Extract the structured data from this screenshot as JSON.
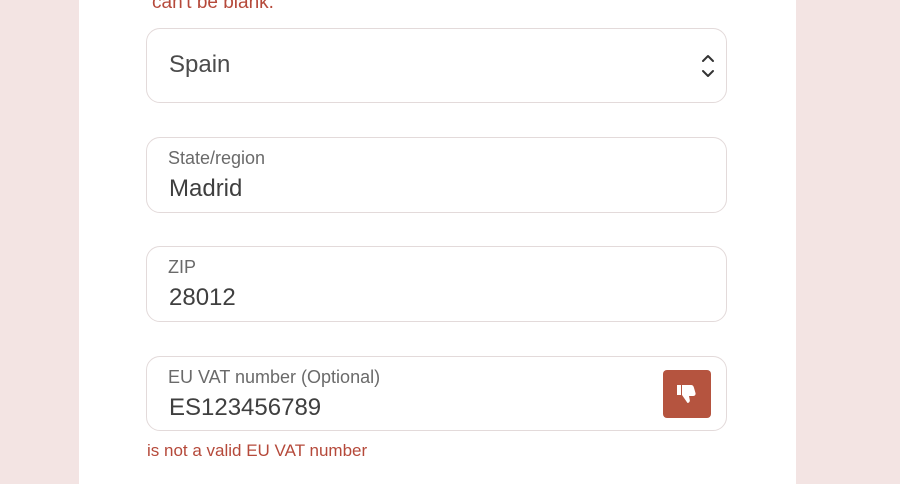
{
  "form": {
    "top_error": "can't be blank.",
    "country": {
      "value": "Spain",
      "icon": "chevron-up-down-icon"
    },
    "state": {
      "label": "State/region",
      "value": "Madrid"
    },
    "zip": {
      "label": "ZIP",
      "value": "28012"
    },
    "vat": {
      "label": "EU VAT number (Optional)",
      "value": "ES123456789",
      "icon": "thumbs-down-icon",
      "error": "is not a valid EU VAT number"
    }
  },
  "colors": {
    "background": "#f3e4e3",
    "card": "#ffffff",
    "error": "#b5493a",
    "button": "#b5543f",
    "border": "#e3dada"
  }
}
